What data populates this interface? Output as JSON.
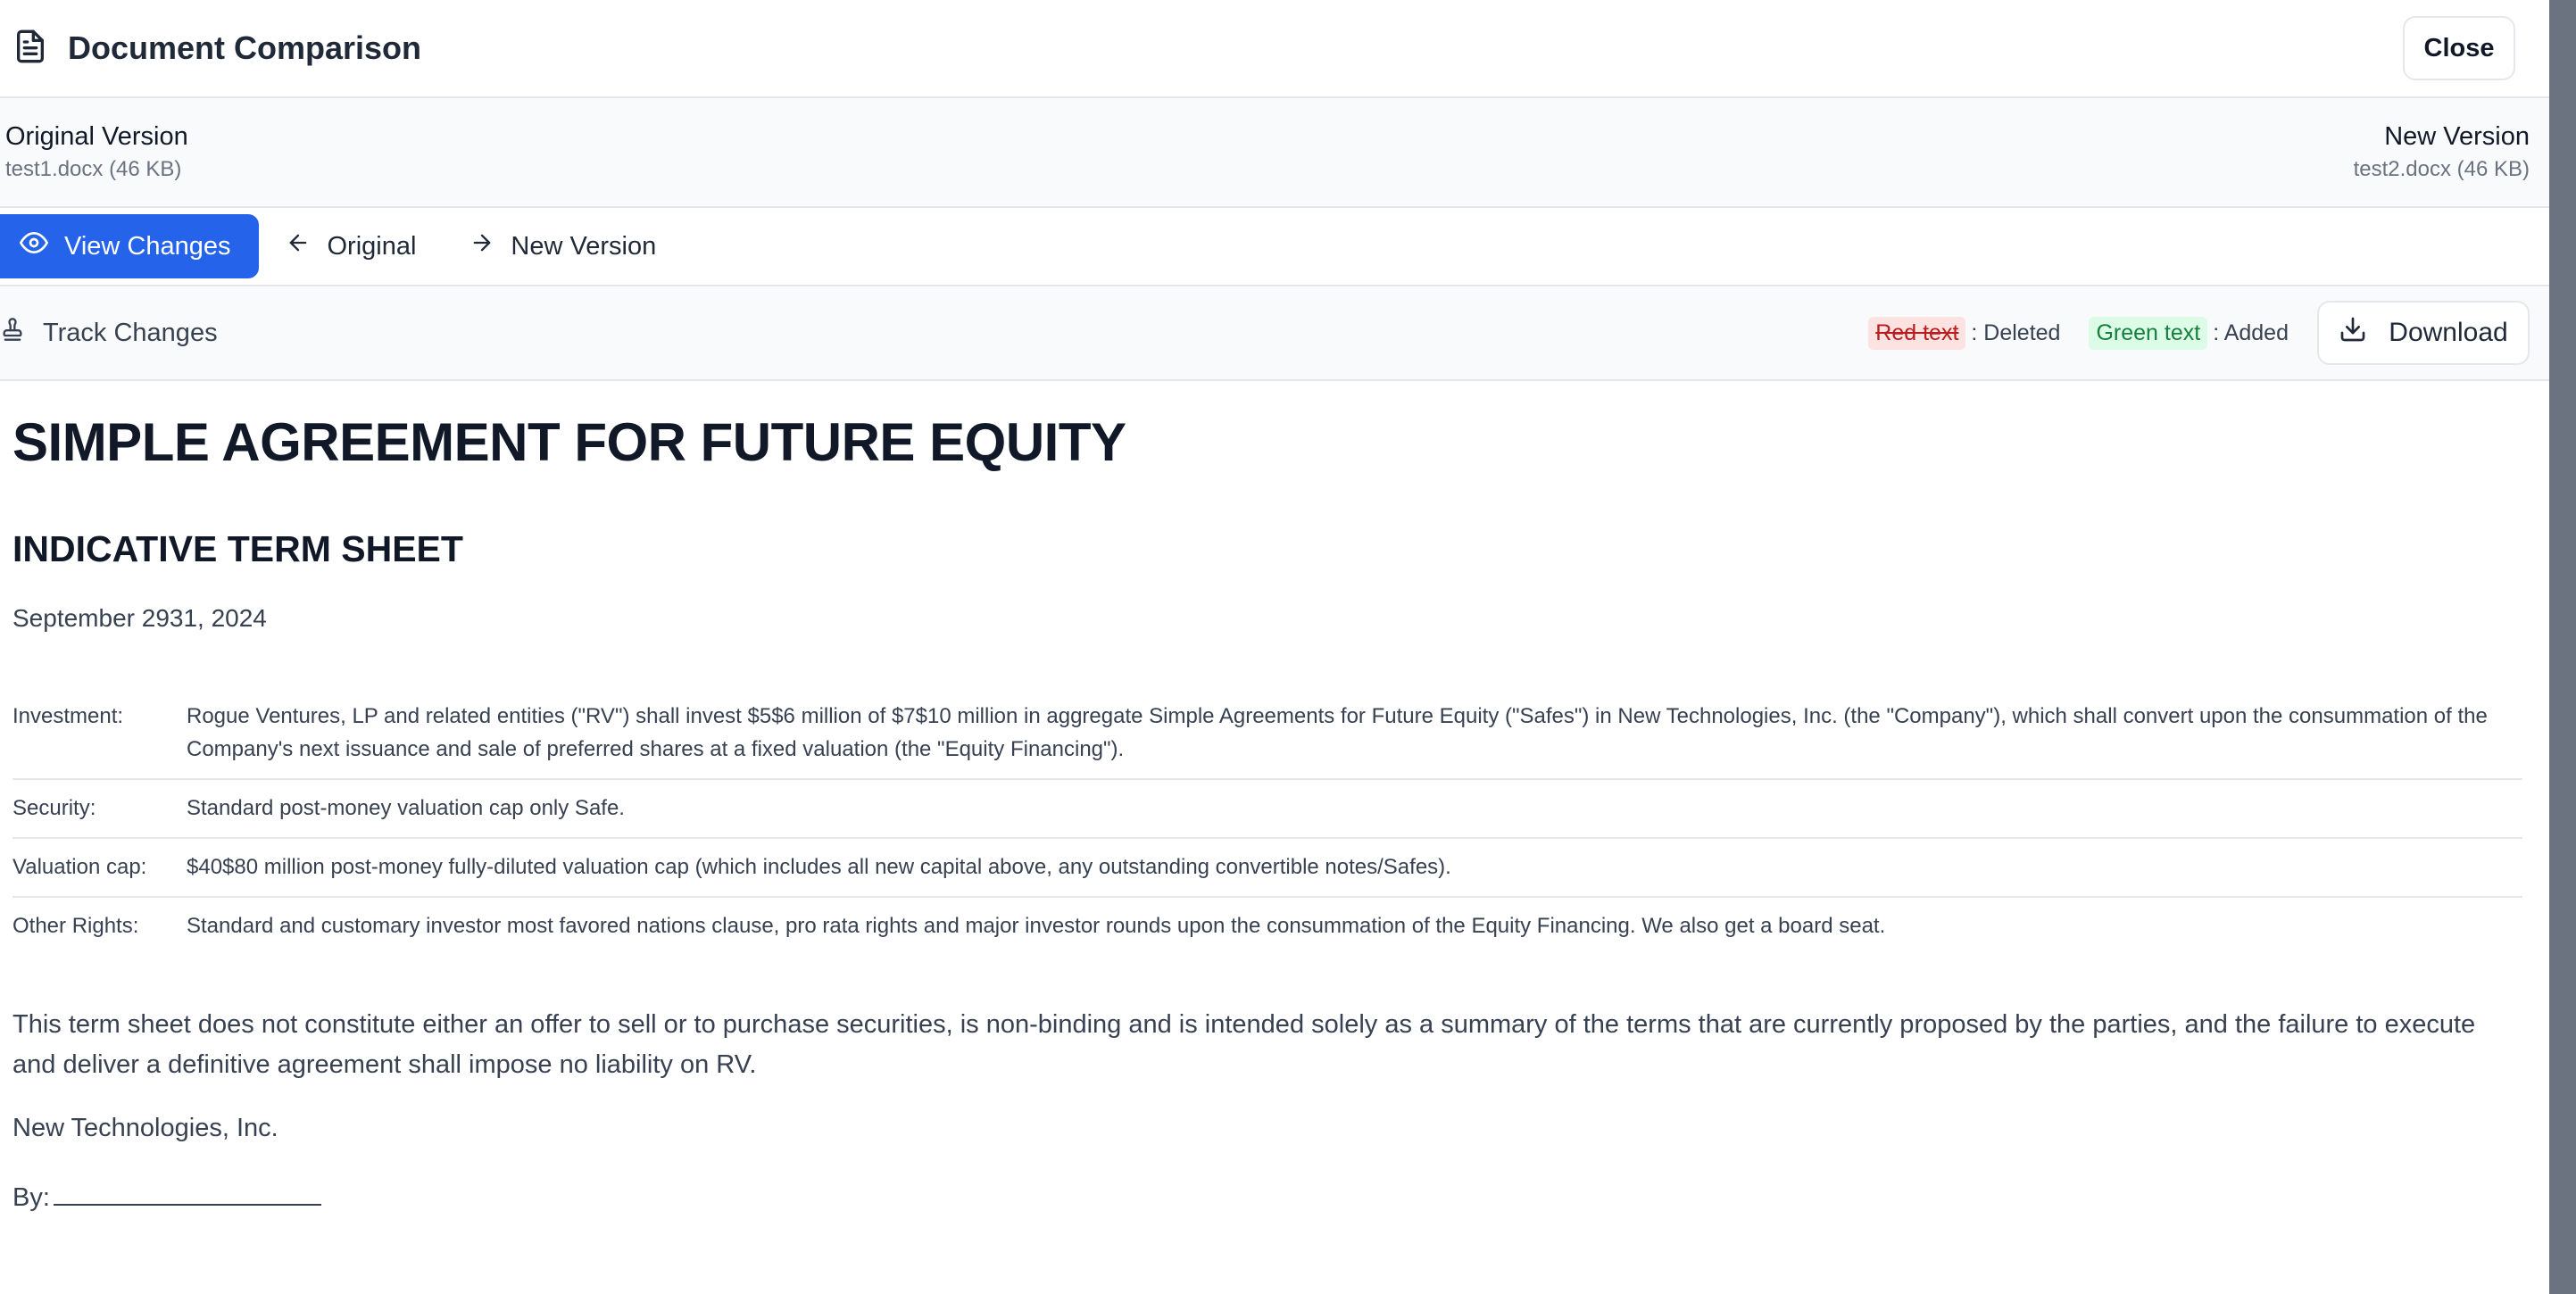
{
  "header": {
    "title": "Document Comparison",
    "close_label": "Close"
  },
  "versions": {
    "original": {
      "title": "Original Version",
      "file": "test1.docx (46 KB)"
    },
    "new": {
      "title": "New Version",
      "file": "test2.docx (46 KB)"
    }
  },
  "tabs": [
    {
      "label": "View Changes",
      "icon": "eye-icon",
      "active": true
    },
    {
      "label": "Original",
      "icon": "arrow-left-icon",
      "active": false
    },
    {
      "label": "New Version",
      "icon": "arrow-right-icon",
      "active": false
    }
  ],
  "track": {
    "label": "Track Changes",
    "legend_deleted_sample": "Red text",
    "legend_deleted_label": ": Deleted",
    "legend_added_sample": "Green text",
    "legend_added_label": ": Added",
    "download_label": "Download"
  },
  "document": {
    "title": "SIMPLE AGREEMENT FOR FUTURE EQUITY",
    "subtitle": "INDICATIVE TERM SHEET",
    "date": "September 2931, 2024",
    "terms": [
      {
        "label": "Investment:",
        "value": "Rogue Ventures, LP and related entities (\"RV\") shall invest $5$6 million of $7$10 million in aggregate Simple Agreements for Future Equity (\"Safes\") in New Technologies, Inc. (the \"Company\"), which shall convert upon the consummation of the Company's next issuance and sale of preferred shares at a fixed valuation (the \"Equity Financing\")."
      },
      {
        "label": "Security:",
        "value": "Standard post-money valuation cap only Safe."
      },
      {
        "label": "Valuation cap:",
        "value": "$40$80 million post-money fully-diluted valuation cap (which includes all new capital above, any outstanding convertible notes/Safes)."
      },
      {
        "label": "Other Rights:",
        "value": "Standard and customary investor most favored nations clause, pro rata rights and major investor rounds upon the consummation of the Equity Financing. We also get a board seat."
      }
    ],
    "disclaimer": "This term sheet does not constitute either an offer to sell or to purchase securities, is non-binding and is intended solely as a summary of the terms that are currently proposed by the parties, and the failure to execute and deliver a definitive agreement shall impose no liability on RV.",
    "company": "New Technologies, Inc.",
    "by_label": "By:"
  },
  "colors": {
    "accent": "#2563eb",
    "deleted_bg": "#fde2e2",
    "deleted_text": "#b91c1c",
    "added_bg": "#dcfce7",
    "added_text": "#15803d"
  }
}
